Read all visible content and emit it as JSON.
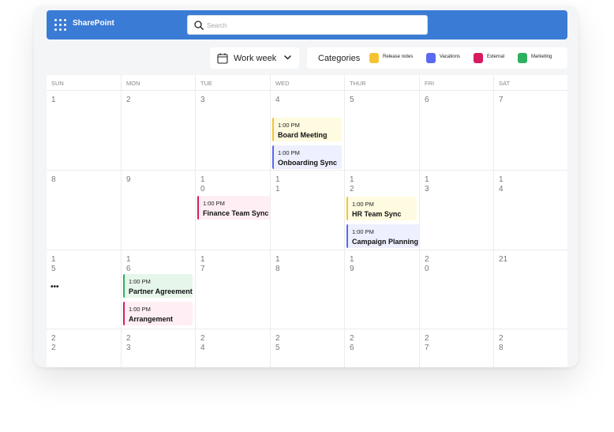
{
  "header": {
    "brand": "SharePoint",
    "search_placeholder": "Search"
  },
  "toolbar": {
    "view_label": "Work week",
    "categories_title": "Categories",
    "categories": [
      {
        "label": "Release notes",
        "color": "#f4c430"
      },
      {
        "label": "Vacations",
        "color": "#5b68f0"
      },
      {
        "label": "External",
        "color": "#d81b60"
      },
      {
        "label": "Marketing",
        "color": "#2eb15f"
      }
    ]
  },
  "calendar": {
    "days": [
      "SUN",
      "MON",
      "TUE",
      "WED",
      "THUR",
      "FRI",
      "SAT"
    ],
    "weeks": [
      [
        "1",
        "2",
        "3",
        "4",
        "5",
        "6",
        "7"
      ],
      [
        "8",
        "9",
        "10",
        "11",
        "12",
        "13",
        "14"
      ],
      [
        "15",
        "16",
        "17",
        "18",
        "19",
        "20",
        "21"
      ],
      [
        "22",
        "23",
        "24",
        "25",
        "26",
        "27",
        "28"
      ]
    ],
    "more_indicator": "•••",
    "events": [
      {
        "time": "1:00 PM",
        "name": "Board Meeting"
      },
      {
        "time": "1:00 PM",
        "name": "Onboarding Sync"
      },
      {
        "time": "1:00 PM",
        "name": "Finance Team Sync"
      },
      {
        "time": "1:00 PM",
        "name": "HR Team Sync"
      },
      {
        "time": "1:00 PM",
        "name": "Campaign Planning"
      },
      {
        "time": "1:00 PM",
        "name": "Partner Agreement"
      },
      {
        "time": "1:00 PM",
        "name": "Arrangement"
      }
    ]
  }
}
